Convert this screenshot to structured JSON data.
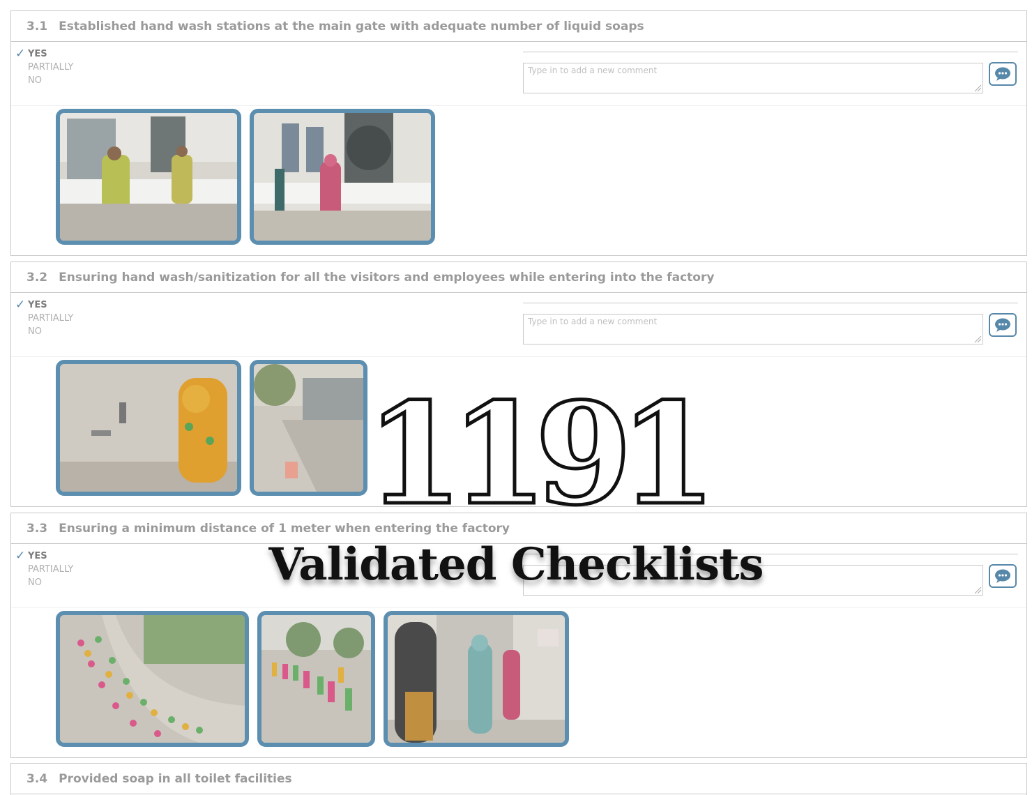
{
  "sections": [
    {
      "number": "3.1",
      "title": "Established hand wash stations at the main gate with adequate number of liquid soaps",
      "options": [
        "YES",
        "PARTIALLY",
        "NO"
      ],
      "selected": "YES",
      "comment_placeholder": "Type in to add a new comment",
      "photos": 2
    },
    {
      "number": "3.2",
      "title": "Ensuring hand wash/sanitization for all the visitors and employees while entering into the factory",
      "options": [
        "YES",
        "PARTIALLY",
        "NO"
      ],
      "selected": "YES",
      "comment_placeholder": "Type in to add a new comment",
      "photos": 2
    },
    {
      "number": "3.3",
      "title": "Ensuring a minimum distance of 1 meter when entering the factory",
      "options": [
        "YES",
        "PARTIALLY",
        "NO"
      ],
      "selected": "YES",
      "comment_placeholder": "",
      "photos": 3
    },
    {
      "number": "3.4",
      "title": "Provided soap in all toilet facilities"
    }
  ],
  "overlay": {
    "count": "1191",
    "caption": "Validated Checklists"
  },
  "colors": {
    "accent": "#5c8eb0",
    "border": "#c8c8c8",
    "muted_text": "#9a9a9a"
  },
  "icons": {
    "selected_marker": "checkmark-icon",
    "comment_button": "comment-bubble-icon"
  }
}
